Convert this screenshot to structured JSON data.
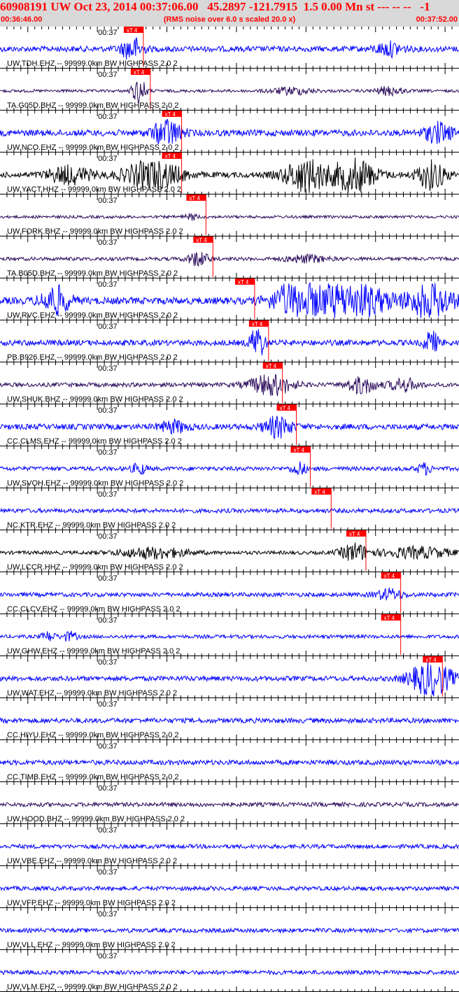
{
  "header": {
    "title": "60908191 UW Oct 23, 2014 00:37:06.00   45.2897 -121.7915  1.5 0.00 Mn st --- -- --   -1",
    "start_time": "00:36:46.00",
    "end_time": "00:37:52.00",
    "subtitle": "(RMS noise over 6.0 s scaled 20.0 x)"
  },
  "colors": {
    "blue": "#0000ff",
    "black": "#000000",
    "purple": "#2a0a5a",
    "pick_red": "#ff0000",
    "header_bg": "#d9d9d9"
  },
  "chart_data": {
    "type": "line",
    "time_range": [
      "00:36:46.00",
      "00:37:52.00"
    ],
    "tick_label": "00:37",
    "pick_label": "xT 4",
    "traces": [
      {
        "label": "UW.TDH.EHZ -- 99999.0km BW  HIGHPASS  2.0  2",
        "color": "blue",
        "pick_sec": 18.0,
        "noise": 4,
        "bursts": [
          [
            19,
            1.5,
            4
          ],
          [
            56,
            2,
            2.2
          ]
        ]
      },
      {
        "label": "TA.G05D.BHZ -- 99999.0km BW  HIGHPASS  2.0  2",
        "color": "purple",
        "pick_sec": 19.0,
        "noise": 2,
        "bursts": [
          [
            20,
            1,
            9
          ],
          [
            42,
            3,
            2.5
          ],
          [
            56,
            2,
            3
          ]
        ]
      },
      {
        "label": "UW.NCO.EHZ -- 99999.0km BW  HIGHPASS  2.0  2",
        "color": "blue",
        "pick_sec": 23.5,
        "noise": 4.5,
        "bursts": [
          [
            24,
            2,
            4
          ],
          [
            63,
            2,
            3
          ]
        ]
      },
      {
        "label": "UW.YACT.HHZ -- 99999.0km BW  HIGHPASS  2.0  2",
        "color": "black",
        "pick_sec": 23.5,
        "noise": 4,
        "bursts": [
          [
            10,
            3,
            3
          ],
          [
            22,
            4,
            5
          ],
          [
            44,
            3,
            6
          ],
          [
            51,
            3,
            6
          ],
          [
            62,
            2,
            5
          ]
        ]
      },
      {
        "label": "UW.FORK.BHZ -- 99999.0km BW  HIGHPASS  2.0  2",
        "color": "purple",
        "pick_sec": 27.0,
        "noise": 2,
        "bursts": [
          [
            27.5,
            1,
            2
          ]
        ]
      },
      {
        "label": "TA.B05D.BHZ -- 99999.0km BW  HIGHPASS  2.0  2",
        "color": "purple",
        "pick_sec": 28.0,
        "noise": 2.5,
        "bursts": [
          [
            28.5,
            1.5,
            4
          ],
          [
            44,
            3,
            2
          ]
        ]
      },
      {
        "label": "UW.RVC.EHZ -- 99999.0km BW  HIGHPASS  2.0  2",
        "color": "blue",
        "pick_sec": 34.0,
        "noise": 5,
        "bursts": [
          [
            8,
            2,
            4
          ],
          [
            42,
            3,
            4
          ],
          [
            50,
            6,
            5
          ],
          [
            62,
            3,
            5
          ]
        ]
      },
      {
        "label": "PB.B926.EHZ -- 99999.0km BW  HIGHPASS  2.0  2",
        "color": "blue",
        "pick_sec": 36.0,
        "noise": 4,
        "bursts": [
          [
            37,
            1,
            6
          ],
          [
            62,
            1,
            4
          ]
        ]
      },
      {
        "label": "UW.SHUK.BHZ -- 99999.0km BW  HIGHPASS  2.0  2",
        "color": "purple",
        "pick_sec": 38.0,
        "noise": 3,
        "bursts": [
          [
            39,
            3,
            5
          ],
          [
            52,
            2,
            4
          ],
          [
            58,
            2,
            3
          ]
        ]
      },
      {
        "label": "CC.CLMS.EHZ -- 99999.0km BW  HIGHPASS  2.0  2",
        "color": "blue",
        "pick_sec": 40.0,
        "noise": 4,
        "bursts": [
          [
            25,
            2,
            2
          ],
          [
            40,
            2,
            3.5
          ]
        ]
      },
      {
        "label": "UW.SVOH.EHZ -- 99999.0km BW  HIGHPASS  2.0  2",
        "color": "blue",
        "pick_sec": 42.0,
        "noise": 3,
        "bursts": [
          [
            20,
            1,
            2.5
          ],
          [
            43,
            1,
            3
          ],
          [
            61,
            1,
            2.5
          ]
        ]
      },
      {
        "label": "NC.KTR.EHZ -- 99999.0km BW  HIGHPASS  2.0  2",
        "color": "blue",
        "pick_sec": 45.0,
        "noise": 3,
        "bursts": []
      },
      {
        "label": "UW.LCCR.HHZ -- 99999.0km BW  HIGHPASS  2.0  2",
        "color": "black",
        "pick_sec": 50.0,
        "noise": 2.5,
        "bursts": [
          [
            22,
            5,
            3
          ],
          [
            51,
            2,
            5
          ],
          [
            60,
            5,
            3
          ]
        ]
      },
      {
        "label": "CC.CLCV.EHZ -- 99999.0km BW  HIGHPASS  2.0  2",
        "color": "blue",
        "pick_sec": 55.0,
        "noise": 3,
        "bursts": [
          [
            56,
            2,
            2.5
          ]
        ]
      },
      {
        "label": "UW.GHW.EHZ -- 99999.0km BW  HIGHPASS  2.0  2",
        "color": "blue",
        "pick_sec": 55.0,
        "noise": 2.5,
        "bursts": [
          [
            7,
            1,
            2.5
          ],
          [
            10,
            1,
            2.5
          ]
        ]
      },
      {
        "label": "UW.WAT.EHZ -- 99999.0km BW  HIGHPASS  2.0  2",
        "color": "blue",
        "pick_sec": 61.0,
        "noise": 3.5,
        "bursts": [
          [
            62,
            3,
            7
          ]
        ]
      },
      {
        "label": "CC.HIYU.EHZ -- 99999.0km BW  HIGHPASS  2.0  2",
        "color": "blue",
        "pick_sec": null,
        "noise": 3.5,
        "bursts": []
      },
      {
        "label": "CC.TIMB.EHZ -- 99999.0km BW  HIGHPASS  2.0  2",
        "color": "blue",
        "pick_sec": null,
        "noise": 3.5,
        "bursts": []
      },
      {
        "label": "UW.HOOD.BHZ -- 99999.0km BW  HIGHPASS  2.0  2",
        "color": "purple",
        "pick_sec": null,
        "noise": 3,
        "bursts": []
      },
      {
        "label": "UW.VBE.EHZ -- 99999.0km BW  HIGHPASS  2.0  2",
        "color": "blue",
        "pick_sec": null,
        "noise": 3,
        "bursts": []
      },
      {
        "label": "UW.VFP.EHZ -- 99999.0km BW  HIGHPASS  2.0  2",
        "color": "blue",
        "pick_sec": null,
        "noise": 3,
        "bursts": []
      },
      {
        "label": "UW.VLL.EHZ -- 99999.0km BW  HIGHPASS  2.0  2",
        "color": "blue",
        "pick_sec": null,
        "noise": 3,
        "bursts": []
      },
      {
        "label": "UW.VLM.EHZ -- 99999.0km BW  HIGHPASS  2.0  2",
        "color": "blue",
        "pick_sec": null,
        "noise": 3,
        "bursts": []
      }
    ]
  }
}
